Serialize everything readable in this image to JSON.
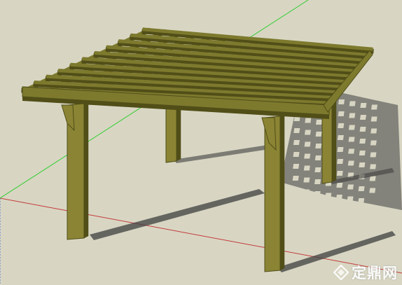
{
  "viewport": {
    "background_color": "#d8d6c3",
    "axes": {
      "red_axis_color": "#c43a3a",
      "green_axis_color": "#2ecc2e",
      "blue_axis_color": "#4a6fd6"
    }
  },
  "model": {
    "wood_color": "#7d7a2e",
    "wood_dark_color": "#514e18",
    "post_color": "#8a8434",
    "shadow_color": "#3f3f3f"
  },
  "watermark": {
    "text": "定鼎网",
    "logo_icon": "diamond-logo-icon",
    "color": "#ffffff"
  }
}
